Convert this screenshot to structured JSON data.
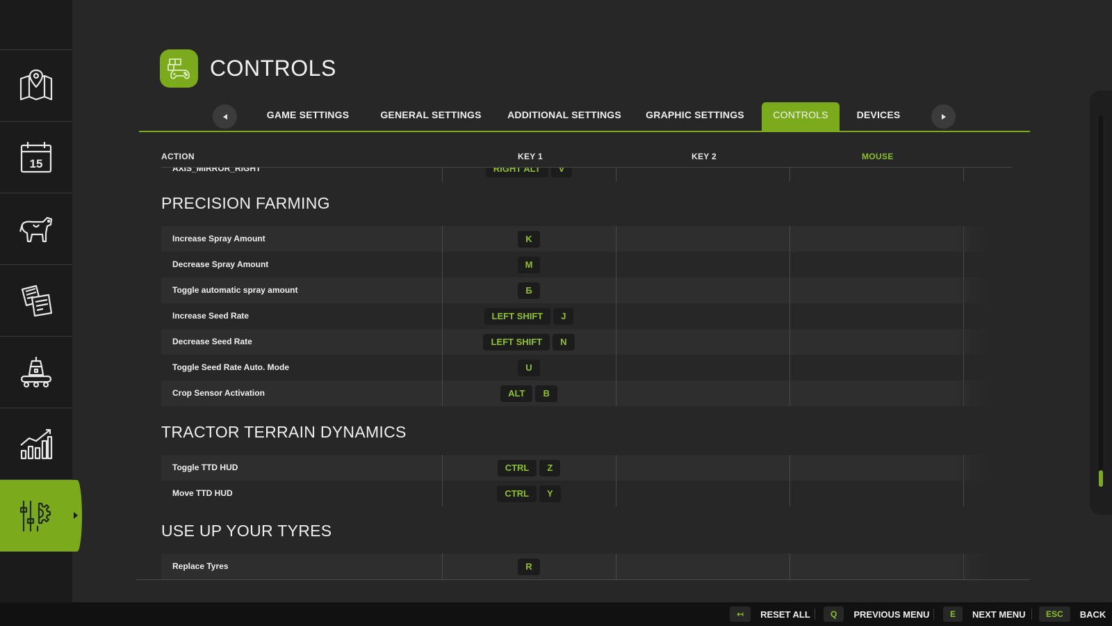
{
  "header": {
    "title": "CONTROLS"
  },
  "sidebar": {
    "items": [
      {
        "icon": "map-icon"
      },
      {
        "icon": "calendar-icon",
        "day": "15"
      },
      {
        "icon": "cow-icon"
      },
      {
        "icon": "contracts-icon"
      },
      {
        "icon": "production-icon"
      },
      {
        "icon": "statistics-icon"
      },
      {
        "icon": "settings-sliders-icon",
        "active": true
      }
    ]
  },
  "tabs": [
    {
      "label": "GAME SETTINGS"
    },
    {
      "label": "GENERAL SETTINGS"
    },
    {
      "label": "ADDITIONAL SETTINGS"
    },
    {
      "label": "GRAPHIC SETTINGS"
    },
    {
      "label": "CONTROLS",
      "active": true
    },
    {
      "label": "DEVICES"
    }
  ],
  "columns": {
    "action": "ACTION",
    "key1": "KEY 1",
    "key2": "KEY 2",
    "mouse": "MOUSE"
  },
  "partial_row": {
    "action": "AXIS_MIRROR_RIGHT",
    "keys": [
      "RIGHT ALT",
      "V"
    ]
  },
  "sections": [
    {
      "title": "PRECISION FARMING",
      "rows": [
        {
          "action": "Increase Spray Amount",
          "keys": [
            "K"
          ]
        },
        {
          "action": "Decrease Spray Amount",
          "keys": [
            "M"
          ]
        },
        {
          "action": "Toggle automatic spray amount",
          "keys": [
            "Б"
          ]
        },
        {
          "action": "Increase Seed Rate",
          "keys": [
            "LEFT SHIFT",
            "J"
          ]
        },
        {
          "action": "Decrease Seed Rate",
          "keys": [
            "LEFT SHIFT",
            "N"
          ]
        },
        {
          "action": "Toggle Seed Rate Auto. Mode",
          "keys": [
            "U"
          ]
        },
        {
          "action": "Crop Sensor Activation",
          "keys": [
            "ALT",
            "B"
          ]
        }
      ]
    },
    {
      "title": "TRACTOR TERRAIN DYNAMICS",
      "rows": [
        {
          "action": "Toggle TTD HUD",
          "keys": [
            "CTRL",
            "Z"
          ]
        },
        {
          "action": "Move TTD HUD",
          "keys": [
            "CTRL",
            "Y"
          ]
        }
      ]
    },
    {
      "title": "USE UP YOUR TYRES",
      "rows": [
        {
          "action": "Replace Tyres",
          "keys": [
            "R"
          ]
        }
      ]
    }
  ],
  "footer": {
    "reset": {
      "key": "↤",
      "label": "RESET ALL"
    },
    "previous": {
      "key": "Q",
      "label": "PREVIOUS MENU"
    },
    "next": {
      "key": "E",
      "label": "NEXT MENU"
    },
    "back": {
      "key": "ESC",
      "label": "BACK"
    }
  },
  "colors": {
    "accent": "#7bab1d",
    "key_text": "#90c32a",
    "background": "#272727",
    "sidebar": "#1b1b1b"
  },
  "scroll": {
    "position_fraction": 0.95
  }
}
